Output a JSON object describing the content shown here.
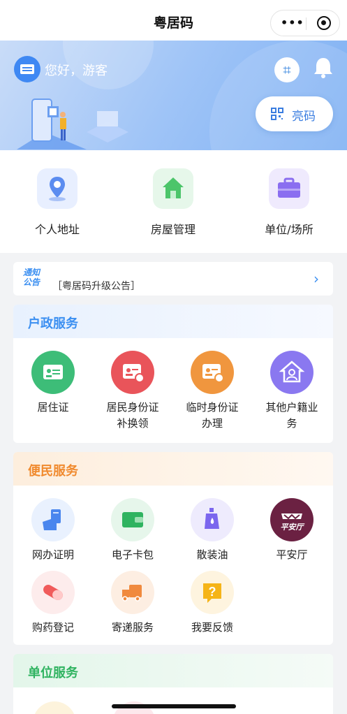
{
  "header": {
    "title": "粤居码",
    "more_icon": "more-dots-icon",
    "close_icon": "target-icon"
  },
  "banner": {
    "greeting": "您好，游客",
    "show_code_label": "亮码"
  },
  "quick_access": [
    {
      "label": "个人地址",
      "icon": "location-icon",
      "color": "#5b8cf0"
    },
    {
      "label": "房屋管理",
      "icon": "house-icon",
      "color": "#4cc56a"
    },
    {
      "label": "单位/场所",
      "icon": "briefcase-icon",
      "color": "#8a6ef0"
    }
  ],
  "notice": {
    "tag_line1": "通知",
    "tag_line2": "公告",
    "text": "［粤居码升级公告］"
  },
  "household_services": {
    "title": "户政服务",
    "color": "#3b8ff1",
    "items": [
      {
        "label": "居住证",
        "color": "#3dbd78"
      },
      {
        "label": "居民身份证补换领",
        "color": "#e9545a"
      },
      {
        "label": "临时身份证办理",
        "color": "#f0963e"
      },
      {
        "label": "其他户籍业务",
        "color": "#8a78f0"
      }
    ]
  },
  "convenience_services": {
    "title": "便民服务",
    "color": "#f08a2e",
    "items": [
      {
        "label": "网办证明"
      },
      {
        "label": "电子卡包"
      },
      {
        "label": "散装油"
      },
      {
        "label": "平安厅",
        "logo_text": "平安厅"
      },
      {
        "label": "购药登记"
      },
      {
        "label": "寄递服务"
      },
      {
        "label": "我要反馈"
      }
    ]
  },
  "unit_services": {
    "title": "单位服务",
    "color": "#2fb360"
  }
}
